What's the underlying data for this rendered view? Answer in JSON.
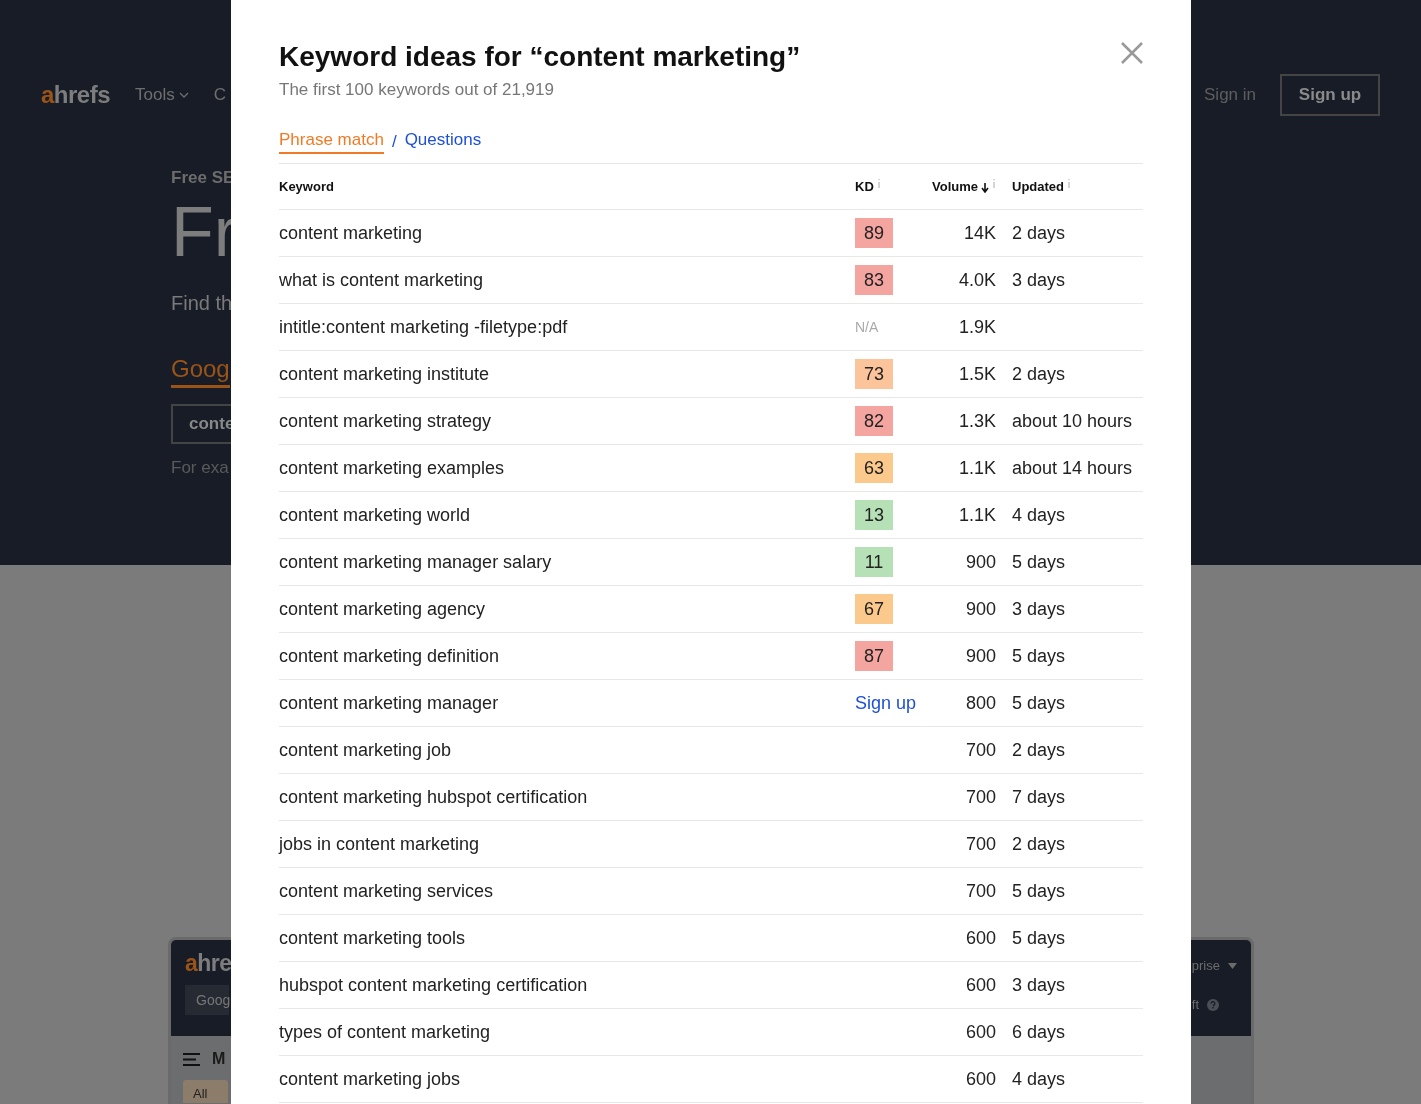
{
  "background": {
    "nav": {
      "logo": {
        "accent": "a",
        "rest": "hrefs"
      },
      "menu": "Tools",
      "menu_cut": "C",
      "sign_in": "Sign in",
      "sign_up": "Sign up"
    },
    "hero": {
      "eyebrow": "Free SE",
      "heading": "Fr",
      "lead": "Find th",
      "tab": "Goog",
      "input_value": "conte",
      "hint": "For exa"
    },
    "card": {
      "logo": {
        "accent": "a",
        "rest": "hre"
      },
      "field": "Goog",
      "title": "M",
      "tab": "All",
      "plan": "prise",
      "note": "ft"
    }
  },
  "modal": {
    "title": "Keyword ideas for “content marketing”",
    "subtitle": "The first 100 keywords out of 21,919",
    "tabs": [
      {
        "label": "Phrase match",
        "selected": true
      },
      {
        "label": "Questions",
        "selected": false
      }
    ],
    "separator": "/",
    "columns": [
      "Keyword",
      "KD",
      "Volume",
      "Updated"
    ],
    "rows": [
      {
        "keyword": "content marketing",
        "kd": {
          "kind": "score",
          "value": "89",
          "color": "#f5a5a0"
        },
        "volume": "14K",
        "updated": "2 days"
      },
      {
        "keyword": "what is content marketing",
        "kd": {
          "kind": "score",
          "value": "83",
          "color": "#f5a5a0"
        },
        "volume": "4.0K",
        "updated": "3 days"
      },
      {
        "keyword": "intitle:content marketing -filetype:pdf",
        "kd": {
          "kind": "na",
          "value": "N/A"
        },
        "volume": "1.9K"
      },
      {
        "keyword": "content marketing institute",
        "kd": {
          "kind": "score",
          "value": "73",
          "color": "#fbc49a"
        },
        "volume": "1.5K",
        "updated": "2 days"
      },
      {
        "keyword": "content marketing strategy",
        "kd": {
          "kind": "score",
          "value": "82",
          "color": "#f5a5a0"
        },
        "volume": "1.3K",
        "updated": "about 10 hours"
      },
      {
        "keyword": "content marketing examples",
        "kd": {
          "kind": "score",
          "value": "63",
          "color": "#fbc98c"
        },
        "volume": "1.1K",
        "updated": "about 14 hours"
      },
      {
        "keyword": "content marketing world",
        "kd": {
          "kind": "score",
          "value": "13",
          "color": "#b6e0b6"
        },
        "volume": "1.1K",
        "updated": "4 days"
      },
      {
        "keyword": "content marketing manager salary",
        "kd": {
          "kind": "score",
          "value": "11",
          "color": "#b6e0b6"
        },
        "volume": "900",
        "updated": "5 days"
      },
      {
        "keyword": "content marketing agency",
        "kd": {
          "kind": "score",
          "value": "67",
          "color": "#fbc98c"
        },
        "volume": "900",
        "updated": "3 days"
      },
      {
        "keyword": "content marketing definition",
        "kd": {
          "kind": "score",
          "value": "87",
          "color": "#f5a5a0"
        },
        "volume": "900",
        "updated": "5 days"
      },
      {
        "keyword": "content marketing manager",
        "kd": {
          "kind": "link",
          "value": "Sign up"
        },
        "volume": "800",
        "updated": "5 days"
      },
      {
        "keyword": "content marketing job",
        "volume": "700",
        "updated": "2 days"
      },
      {
        "keyword": "content marketing hubspot certification",
        "volume": "700",
        "updated": "7 days"
      },
      {
        "keyword": "jobs in content marketing",
        "volume": "700",
        "updated": "2 days"
      },
      {
        "keyword": "content marketing services",
        "volume": "700",
        "updated": "5 days"
      },
      {
        "keyword": "content marketing tools",
        "volume": "600",
        "updated": "5 days"
      },
      {
        "keyword": "hubspot content marketing certification",
        "volume": "600",
        "updated": "3 days"
      },
      {
        "keyword": "types of content marketing",
        "volume": "600",
        "updated": "6 days"
      },
      {
        "keyword": "content marketing jobs",
        "volume": "600",
        "updated": "4 days"
      }
    ]
  }
}
